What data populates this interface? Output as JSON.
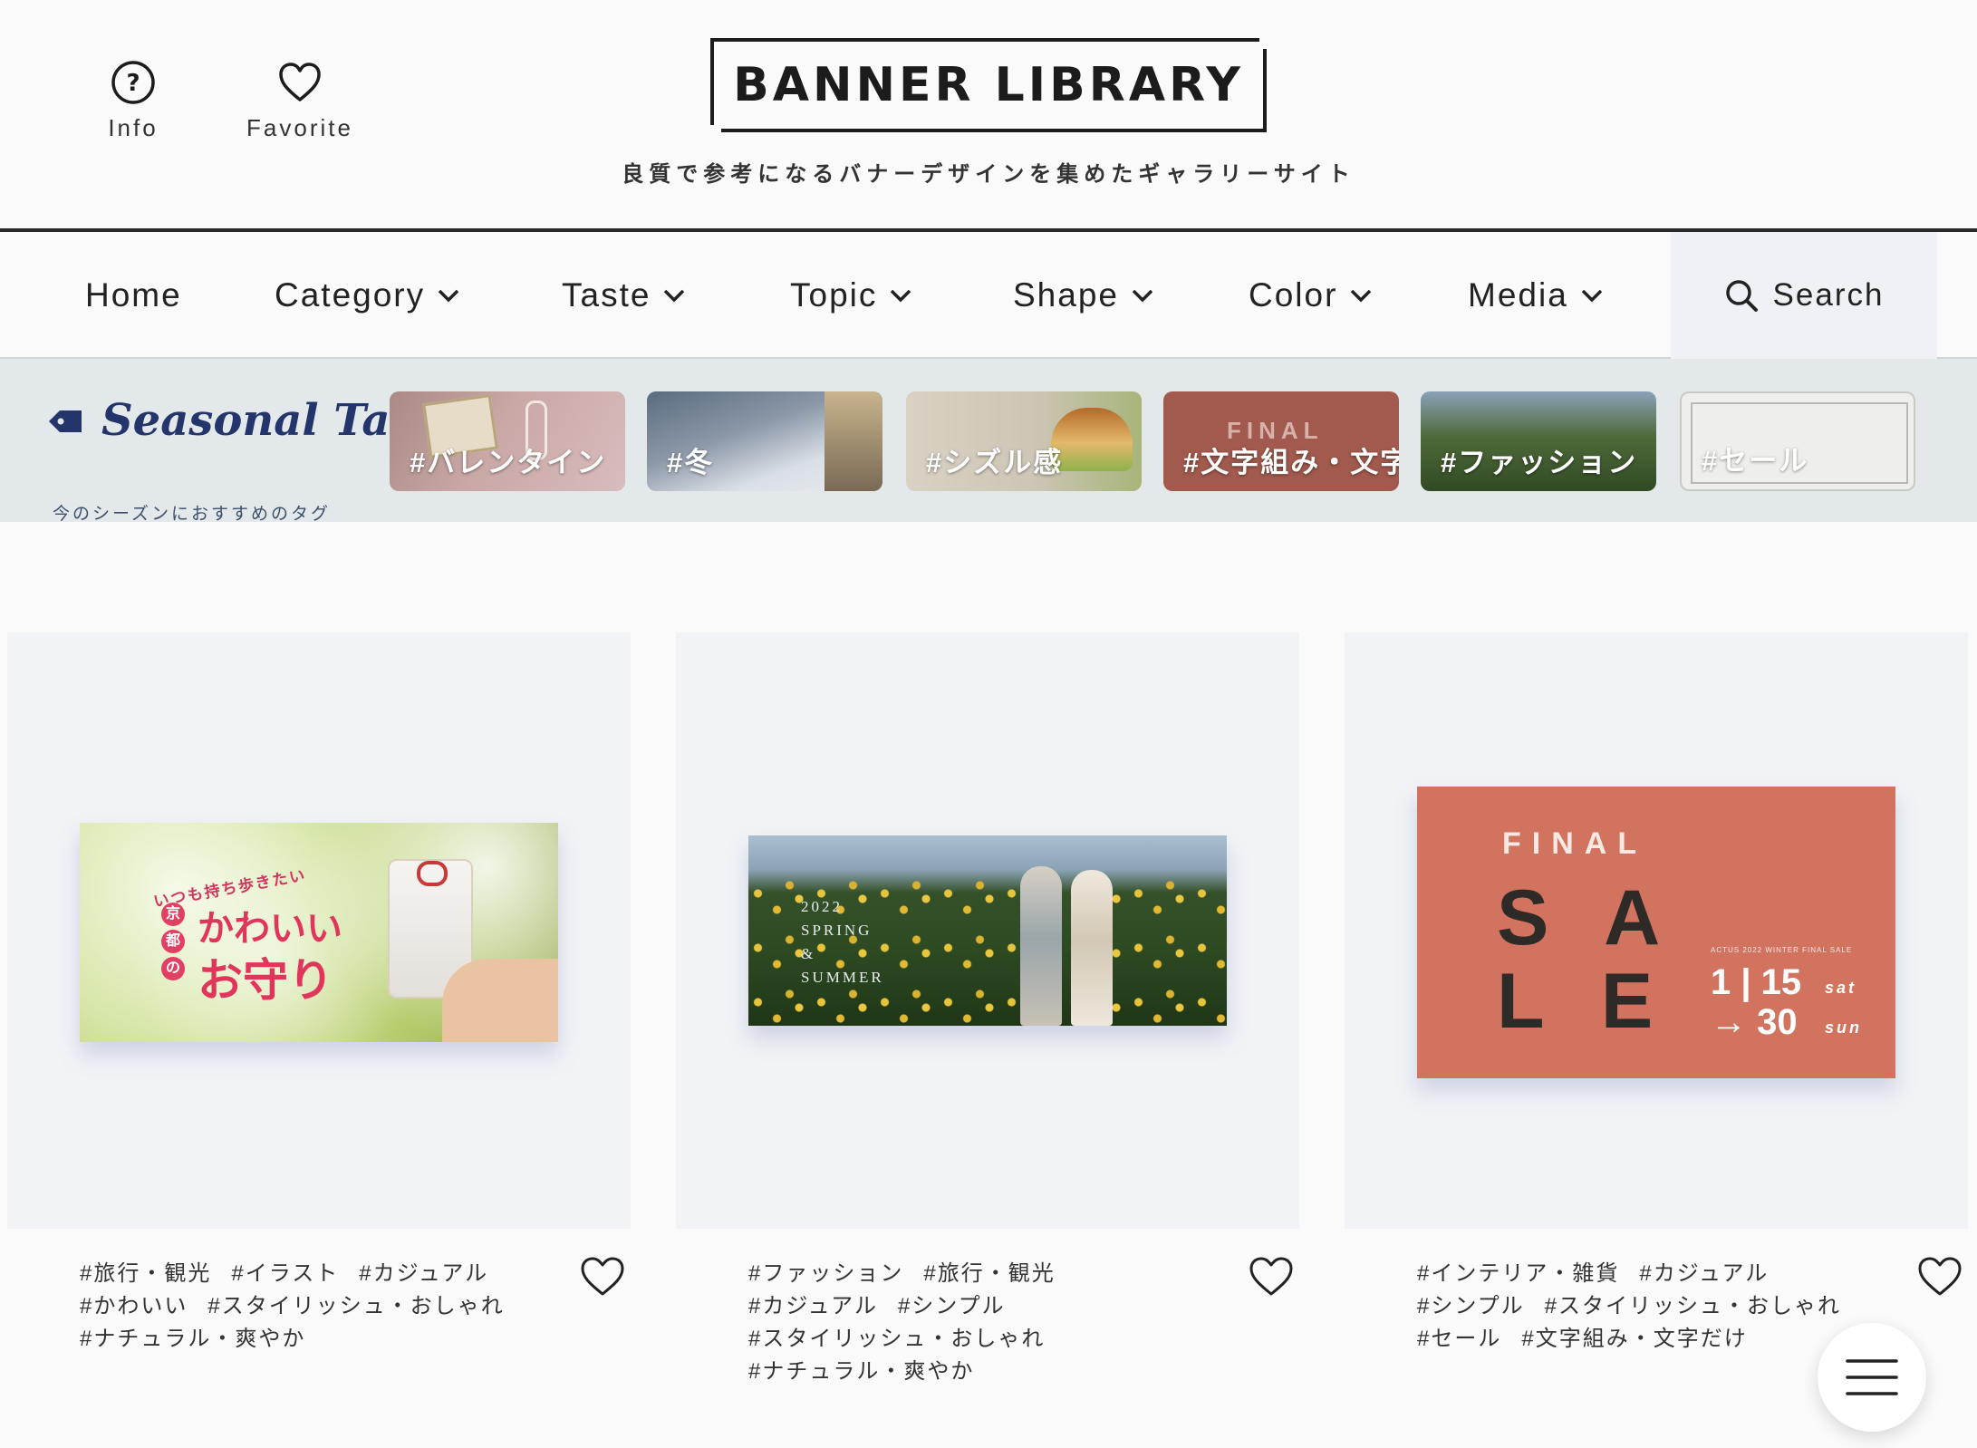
{
  "header": {
    "info_label": "Info",
    "favorite_label": "Favorite",
    "logo": "BANNER LIBRARY",
    "tagline": "良質で参考になるバナーデザインを集めたギャラリーサイト"
  },
  "nav": {
    "items": [
      "Home",
      "Category",
      "Taste",
      "Topic",
      "Shape",
      "Color",
      "Media"
    ],
    "search_label": "Search"
  },
  "seasonal": {
    "title": "Seasonal Tag",
    "subtitle": "今のシーズンにおすすめのタグ",
    "tags": [
      "#バレンタイン",
      "#冬",
      "#シズル感",
      "#文字組み・文字",
      "#ファッション",
      "#セール"
    ]
  },
  "cards": [
    {
      "tags": [
        "#旅行・観光",
        "#イラスト",
        "#カジュアル",
        "#かわいい",
        "#スタイリッシュ・おしゃれ",
        "#ナチュラル・爽やか"
      ],
      "banner": {
        "kicker": "いつも持ち歩きたい",
        "line1": "かわいい",
        "line2": "お守り",
        "circles": [
          "京",
          "都",
          "の"
        ]
      }
    },
    {
      "tags": [
        "#ファッション",
        "#旅行・観光",
        "#カジュアル",
        "#シンプル",
        "#スタイリッシュ・おしゃれ",
        "#ナチュラル・爽やか"
      ],
      "banner": {
        "l1": "2022",
        "l2": "SPRING",
        "l3": "&",
        "l4": "SUMMER"
      }
    },
    {
      "tags": [
        "#インテリア・雑貨",
        "#カジュアル",
        "#シンプル",
        "#スタイリッシュ・おしゃれ",
        "#セール",
        "#文字組み・文字だけ"
      ],
      "banner": {
        "final": "FINAL",
        "sa": "S A",
        "le": "L E",
        "small": "ACTUS 2022 WINTER FINAL SALE",
        "d1": "1 | 15",
        "d1s": "sat",
        "d2": "→ 30",
        "d2s": "sun"
      }
    }
  ]
}
